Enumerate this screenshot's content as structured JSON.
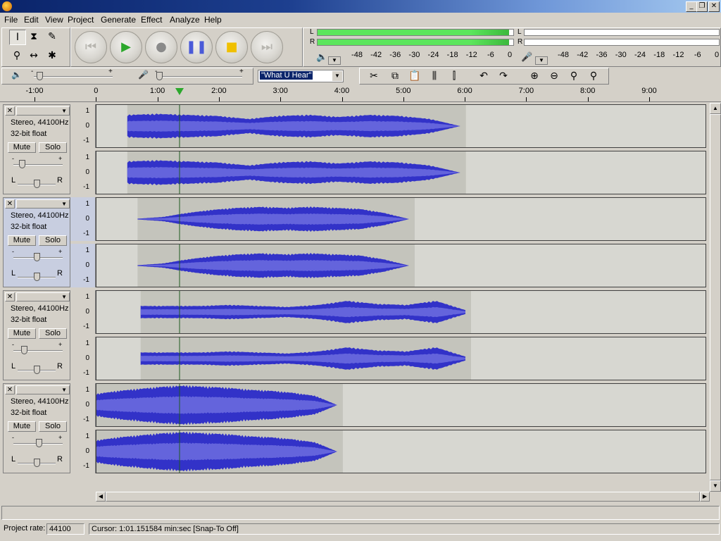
{
  "menu": [
    "File",
    "Edit",
    "View",
    "Project",
    "Generate",
    "Effect",
    "Analyze",
    "Help"
  ],
  "window_buttons": [
    "_",
    "❐",
    "✕"
  ],
  "meter": {
    "left_channel": "L",
    "right_channel": "R",
    "scale": [
      "-48",
      "-42",
      "-36",
      "-30",
      "-24",
      "-18",
      "-12",
      "-6",
      "0"
    ],
    "playback_level_left": 0.98,
    "playback_level_right": 0.98
  },
  "input_source": "\"What U Hear\"",
  "slider_marks": [
    "-",
    "+"
  ],
  "timeline": [
    "-1:00",
    "0",
    "1:00",
    "2:00",
    "3:00",
    "4:00",
    "5:00",
    "6:00",
    "7:00",
    "8:00",
    "9:00"
  ],
  "tracks": [
    {
      "info1": "Stereo, 44100Hz",
      "info2": "32-bit float",
      "mute": "Mute",
      "solo": "Solo",
      "pan_l": "L",
      "pan_r": "R",
      "selected": false
    },
    {
      "info1": "Stereo, 44100Hz",
      "info2": "32-bit float",
      "mute": "Mute",
      "solo": "Solo",
      "pan_l": "L",
      "pan_r": "R",
      "selected": true
    },
    {
      "info1": "Stereo, 44100Hz",
      "info2": "32-bit float",
      "mute": "Mute",
      "solo": "Solo",
      "pan_l": "L",
      "pan_r": "R",
      "selected": false
    },
    {
      "info1": "Stereo, 44100Hz",
      "info2": "32-bit float",
      "mute": "Mute",
      "solo": "Solo",
      "pan_l": "L",
      "pan_r": "R",
      "selected": false
    }
  ],
  "vruler_labels": [
    "1",
    "0",
    "-1"
  ],
  "status": {
    "rate_label": "Project rate:",
    "rate_value": "44100",
    "cursor": "Cursor: 1:01.151584 min:sec   [Snap-To Off]"
  },
  "colors": {
    "waveform": "#3232c8",
    "waveform_rms": "#6464dc",
    "background": "#d7d7d1",
    "meter_green": "#5ce65c"
  }
}
